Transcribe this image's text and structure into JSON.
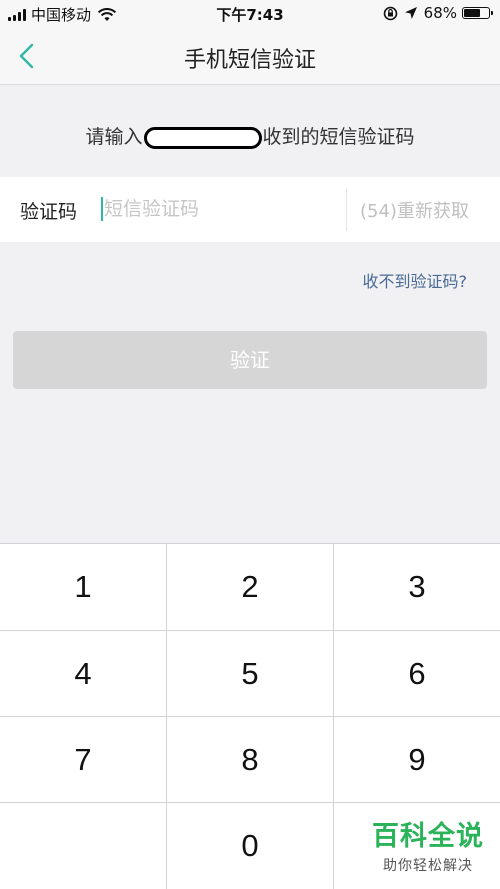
{
  "status_bar": {
    "carrier": "中国移动",
    "time": "下午7:43",
    "battery_percent": "68%",
    "battery_level": 0.68,
    "icons": [
      "signal-icon",
      "wifi-icon",
      "orientation-lock-icon",
      "location-icon",
      "battery-icon"
    ]
  },
  "nav": {
    "back_icon": "chevron-left-icon",
    "title": "手机短信验证"
  },
  "prompt": {
    "prefix": "请输入",
    "suffix": "收到的短信验证码"
  },
  "code_input": {
    "label": "验证码",
    "placeholder": "短信验证码",
    "value": "",
    "resend_label": "(54)重新获取"
  },
  "help_link": "收不到验证码?",
  "verify_button": "验证",
  "keypad": {
    "keys": [
      "1",
      "2",
      "3",
      "4",
      "5",
      "6",
      "7",
      "8",
      "9",
      "",
      "0",
      ""
    ]
  },
  "watermark": {
    "title": "百科全说",
    "subtitle": "助你轻松解决"
  },
  "colors": {
    "accent": "#2fb7a6",
    "link": "#4a6b95",
    "button_disabled": "#d6d6d6",
    "watermark": "#2bb35a"
  }
}
